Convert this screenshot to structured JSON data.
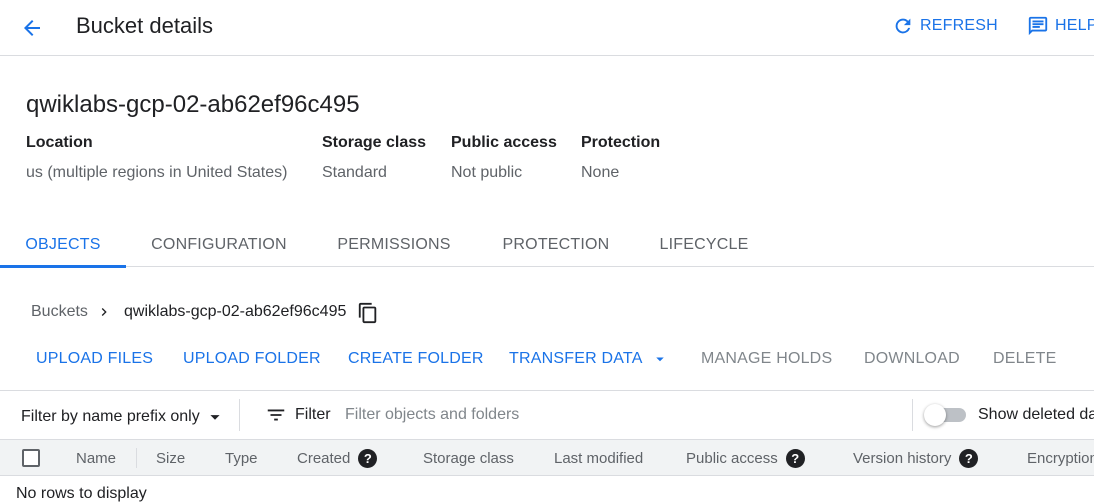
{
  "header": {
    "title": "Bucket details",
    "refresh_label": "REFRESH",
    "help_label": "HELP"
  },
  "bucket": {
    "name": "qwiklabs-gcp-02-ab62ef96c495",
    "info": [
      {
        "label": "Location",
        "value": "us (multiple regions in United States)"
      },
      {
        "label": "Storage class",
        "value": "Standard"
      },
      {
        "label": "Public access",
        "value": "Not public"
      },
      {
        "label": "Protection",
        "value": "None"
      }
    ]
  },
  "tabs": [
    "OBJECTS",
    "CONFIGURATION",
    "PERMISSIONS",
    "PROTECTION",
    "LIFECYCLE"
  ],
  "active_tab": "OBJECTS",
  "breadcrumb": {
    "root": "Buckets",
    "current": "qwiklabs-gcp-02-ab62ef96c495"
  },
  "actions": {
    "upload_files": "UPLOAD FILES",
    "upload_folder": "UPLOAD FOLDER",
    "create_folder": "CREATE FOLDER",
    "transfer_data": "TRANSFER DATA",
    "manage_holds": "MANAGE HOLDS",
    "download": "DOWNLOAD",
    "delete": "DELETE"
  },
  "filter": {
    "prefix_select": "Filter by name prefix only",
    "filter_label": "Filter",
    "placeholder": "Filter objects and folders",
    "show_deleted": "Show deleted data",
    "show_deleted_on": false
  },
  "table": {
    "columns": [
      "Name",
      "Size",
      "Type",
      "Created",
      "Storage class",
      "Last modified",
      "Public access",
      "Version history",
      "Encryption"
    ],
    "empty_message": "No rows to display"
  },
  "colors": {
    "accent": "#1a73e8",
    "text_primary": "#202124",
    "text_secondary": "#5f6368",
    "divider": "#dadce0",
    "table_header_bg": "#f1f3f4"
  }
}
